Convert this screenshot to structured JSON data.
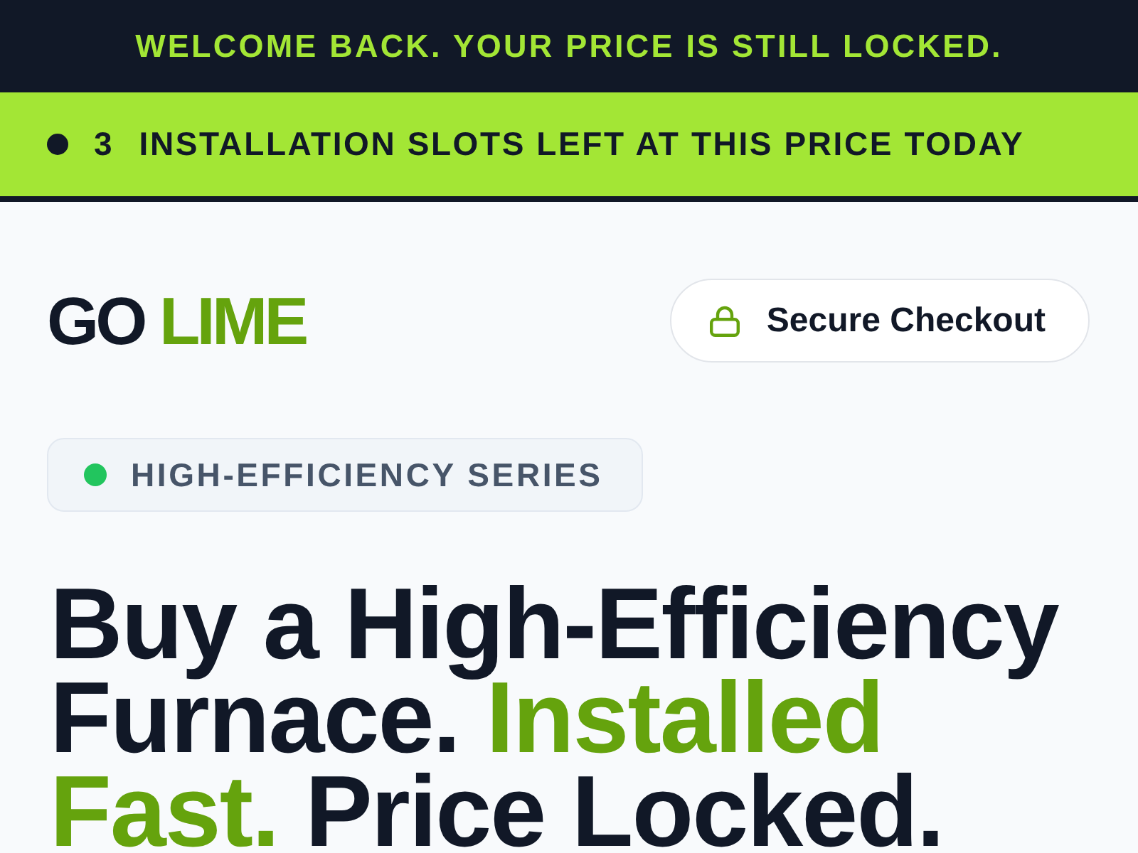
{
  "announcement": {
    "text": "WELCOME BACK. YOUR PRICE IS STILL LOCKED."
  },
  "urgency": {
    "count": "3",
    "text": "INSTALLATION SLOTS LEFT AT THIS PRICE TODAY"
  },
  "header": {
    "logo": [
      {
        "text": "GO",
        "accent": false
      },
      {
        "text": "LIME",
        "accent": true
      }
    ],
    "button": {
      "label": "Secure Checkout"
    }
  },
  "badge": {
    "text": "HIGH-EFFICIENCY SERIES"
  },
  "headline": [
    {
      "text": "Buy a High-Efficiency Furnace.",
      "accent": false
    },
    {
      "text": "Installed Fast.",
      "accent": true
    },
    {
      "text": "Price Locked.",
      "accent": false
    }
  ]
}
